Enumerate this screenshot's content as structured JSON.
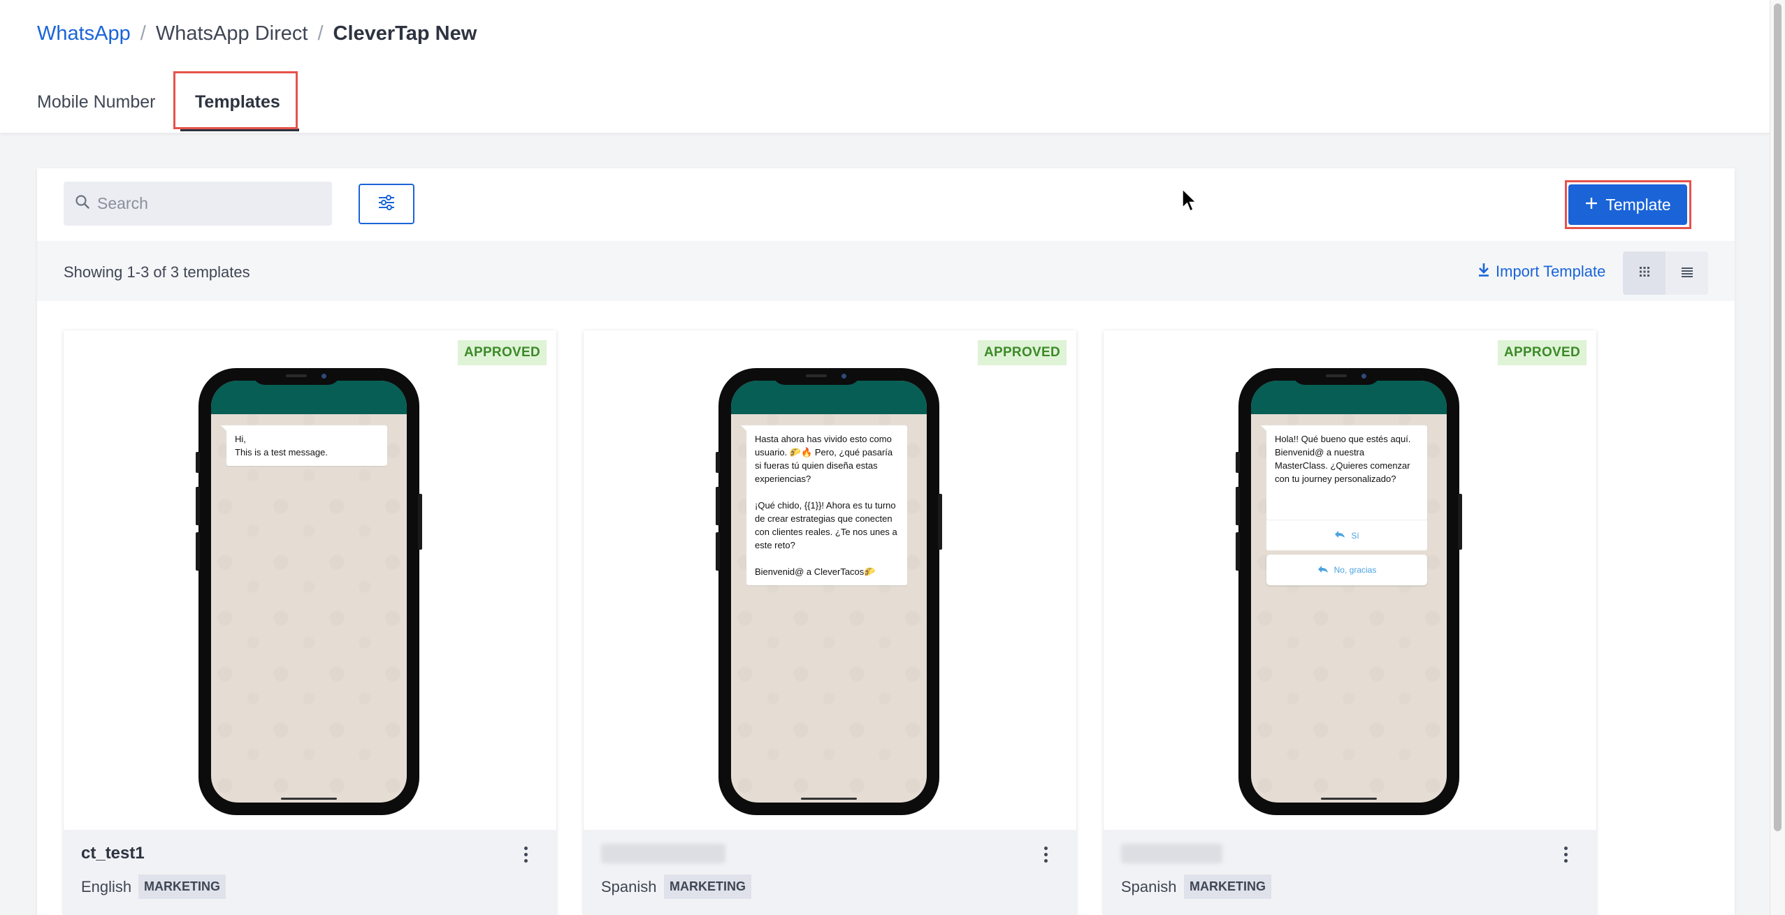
{
  "breadcrumb": {
    "root": "WhatsApp",
    "sep": "/",
    "middle": "WhatsApp Direct",
    "current": "CleverTap New"
  },
  "tabs": {
    "mobile_number": "Mobile Number",
    "templates": "Templates"
  },
  "toolbar": {
    "search_placeholder": "Search",
    "add_label": "Template",
    "count_text": "Showing 1-3 of 3 templates",
    "import_label": "Import Template"
  },
  "icons": {
    "search": "search-icon",
    "filter": "sliders-icon",
    "add": "plus-icon",
    "import": "download-icon",
    "grid_view": "grid-icon",
    "list_view": "list-icon",
    "more": "kebab-icon",
    "reply": "reply-icon"
  },
  "colors": {
    "accent": "#1a64d8",
    "highlight": "#e5534b",
    "approved_bg": "#dff3d6",
    "approved_text": "#3c8a29",
    "whatsapp_bar": "#075e54"
  },
  "templates": [
    {
      "status": "APPROVED",
      "name": "ct_test1",
      "language": "English",
      "category": "MARKETING",
      "message": "Hi,\nThis is a test message.",
      "buttons": []
    },
    {
      "status": "APPROVED",
      "name": "",
      "language": "Spanish",
      "category": "MARKETING",
      "message": "Hasta ahora has vivido esto como usuario. 🌮🔥 Pero, ¿qué pasaría si fueras tú quien diseña estas experiencias?\n\n¡Qué chido, {{1}}! Ahora es tu turno de crear estrategias que conecten con clientes reales. ¿Te nos unes a este reto?\n\nBienvenid@ a CleverTacos🌮",
      "buttons": []
    },
    {
      "status": "APPROVED",
      "name": "",
      "language": "Spanish",
      "category": "MARKETING",
      "message": "Hola!! Qué bueno que estés aquí. Bienvenid@ a nuestra MasterClass. ¿Quieres comenzar con tu journey personalizado?",
      "buttons": [
        "Sí",
        "No, gracias"
      ]
    }
  ]
}
